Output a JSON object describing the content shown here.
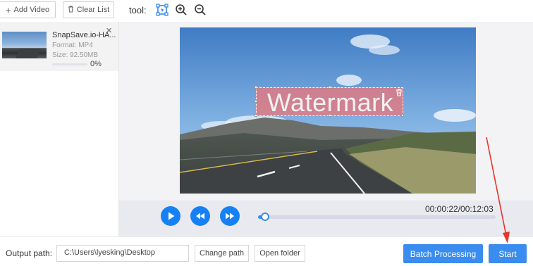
{
  "left_toolbar": {
    "add_video_label": "Add Video",
    "add_video_icon": "plus-icon",
    "clear_list_label": "Clear List",
    "clear_list_icon": "trash-icon"
  },
  "file_list": {
    "items": [
      {
        "name": "SnapSave.io-HA...",
        "format": "Format:  MP4",
        "size": "Size:  92.50MB",
        "progress_text": "0%",
        "progress": 0
      }
    ]
  },
  "toolbar": {
    "label": "tool:",
    "icons": [
      "select-area-icon",
      "zoom-in-icon",
      "zoom-out-icon"
    ]
  },
  "watermark": {
    "text": "Watermark",
    "fill_color": "#e6787d"
  },
  "player": {
    "time": "00:00:22/00:12:03",
    "progress": 0.03,
    "buttons": [
      "play-icon",
      "rewind-icon",
      "fast-forward-icon"
    ]
  },
  "bottom": {
    "output_label": "Output path:",
    "output_value": "C:\\Users\\lyesking\\Desktop",
    "change_path_label": "Change path",
    "open_folder_label": "Open folder",
    "batch_label": "Batch Processing",
    "start_label": "Start"
  },
  "colors": {
    "accent": "#3a8dee",
    "player_button": "#1681f4",
    "annotation_arrow": "#e8342a"
  }
}
